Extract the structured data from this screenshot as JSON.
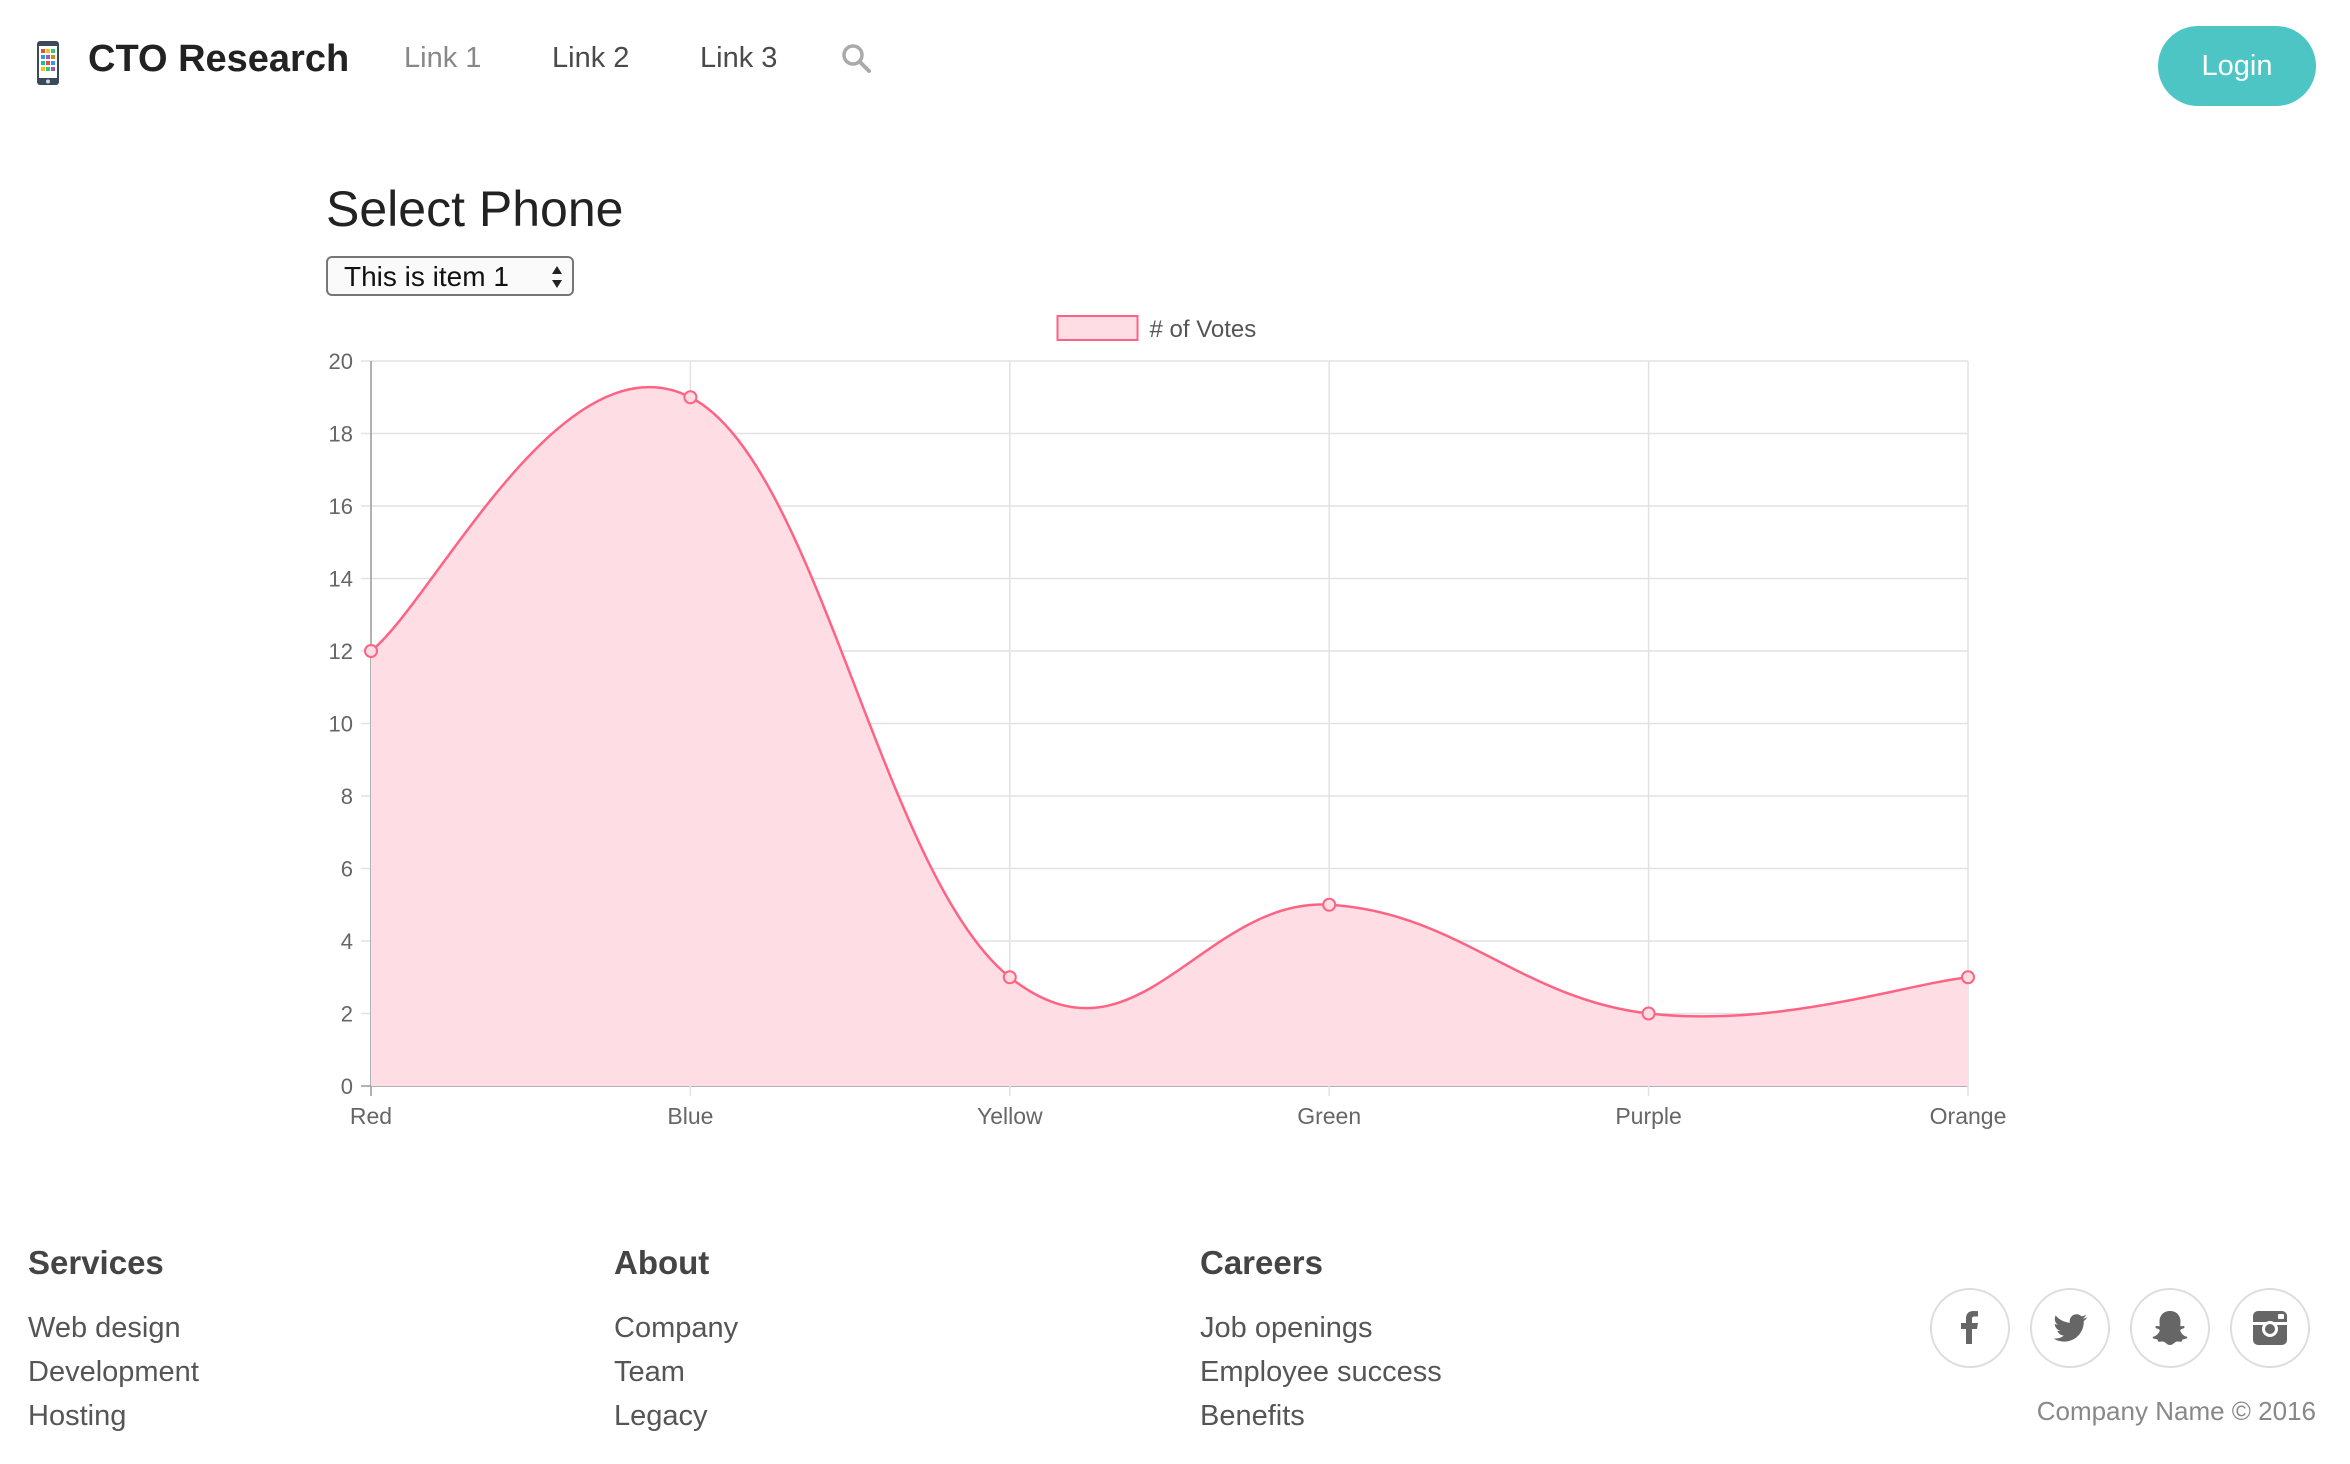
{
  "header": {
    "brand": "CTO Research",
    "nav_links": [
      "Link 1",
      "Link 2",
      "Link 3"
    ],
    "login_label": "Login",
    "accent_color": "#4cc5c4"
  },
  "main": {
    "title": "Select Phone",
    "select": {
      "value": "This is item 1"
    }
  },
  "chart_data": {
    "type": "area",
    "categories": [
      "Red",
      "Blue",
      "Yellow",
      "Green",
      "Purple",
      "Orange"
    ],
    "series": [
      {
        "name": "# of Votes",
        "values": [
          12,
          19,
          3,
          5,
          2,
          3
        ],
        "color": "#ff6384",
        "fill": "#ffdde5"
      }
    ],
    "ylim": [
      0,
      20
    ],
    "yticks": [
      0,
      2,
      4,
      6,
      8,
      10,
      12,
      14,
      16,
      18,
      20
    ],
    "grid": true,
    "legend": "top-center",
    "curve": "smooth"
  },
  "footer": {
    "columns": [
      {
        "heading": "Services",
        "links": [
          "Web design",
          "Development",
          "Hosting"
        ]
      },
      {
        "heading": "About",
        "links": [
          "Company",
          "Team",
          "Legacy"
        ]
      },
      {
        "heading": "Careers",
        "links": [
          "Job openings",
          "Employee success",
          "Benefits"
        ]
      }
    ],
    "social_icons": [
      "facebook-icon",
      "twitter-icon",
      "snapchat-icon",
      "instagram-icon"
    ],
    "copyright": "Company Name © 2016"
  }
}
